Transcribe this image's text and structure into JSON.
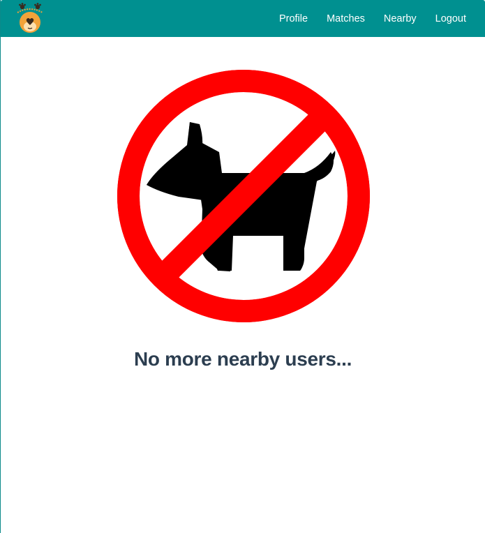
{
  "navbar": {
    "brand_logo": "dog-face-heart-logo",
    "links": [
      {
        "label": "Profile"
      },
      {
        "label": "Matches"
      },
      {
        "label": "Nearby"
      },
      {
        "label": "Logout"
      }
    ],
    "color": "#009090"
  },
  "main": {
    "illustration": "no-dogs-prohibition-sign",
    "message": "No more nearby users..."
  },
  "colors": {
    "prohibition_red": "#ff0000",
    "heading_text": "#2c3e50"
  }
}
